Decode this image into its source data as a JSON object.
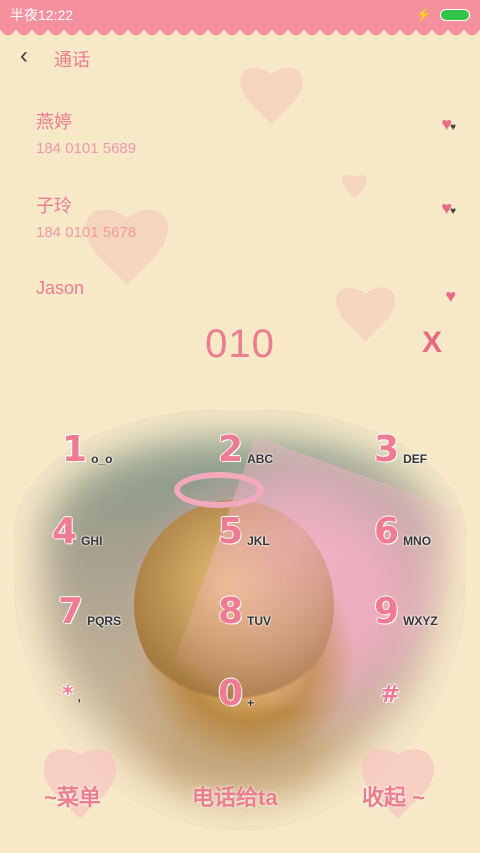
{
  "status": {
    "time": "半夜12:22"
  },
  "header": {
    "title": "通话",
    "back_icon": "‹"
  },
  "contacts": [
    {
      "name": "燕婷",
      "number": "184 0101 5689"
    },
    {
      "name": "子玲",
      "number": "184 0101 5678"
    },
    {
      "name": "Jason",
      "number": ""
    }
  ],
  "dialer": {
    "input": "010",
    "clear_label": "X"
  },
  "keys": [
    {
      "digit": "1",
      "letters": "o_o"
    },
    {
      "digit": "2",
      "letters": "ABC"
    },
    {
      "digit": "3",
      "letters": "DEF"
    },
    {
      "digit": "4",
      "letters": "GHI"
    },
    {
      "digit": "5",
      "letters": "JKL"
    },
    {
      "digit": "6",
      "letters": "MNO"
    },
    {
      "digit": "7",
      "letters": "PQRS"
    },
    {
      "digit": "8",
      "letters": "TUV"
    },
    {
      "digit": "9",
      "letters": "WXYZ"
    },
    {
      "digit": "*",
      "letters": ","
    },
    {
      "digit": "0",
      "letters": "+"
    },
    {
      "digit": "#",
      "letters": ""
    }
  ],
  "bottom": {
    "menu_label": "~菜单",
    "call_label": "电话给ta",
    "collapse_label": "收起 ~"
  }
}
